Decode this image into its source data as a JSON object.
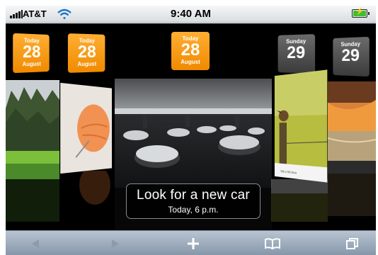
{
  "status_bar": {
    "carrier": "AT&T",
    "time": "9:40 AM",
    "battery_level": 1.0
  },
  "date_tiles": [
    {
      "dow": "Today",
      "day": "28",
      "month": "August",
      "color": "#f39a10"
    },
    {
      "dow": "Today",
      "day": "28",
      "month": "August",
      "color": "#f39a10"
    },
    {
      "dow": "Today",
      "day": "28",
      "month": "August",
      "color": "#f39a10"
    },
    {
      "dow": "Sunday",
      "day": "29",
      "month": "",
      "color": "#4a4a4a"
    },
    {
      "dow": "Sunday",
      "day": "29",
      "month": "",
      "color": "#4a4a4a"
    }
  ],
  "event": {
    "title": "Look for a new car",
    "time": "Today, 6 p.m."
  },
  "toolbar": {
    "icons": [
      "back-arrow-icon",
      "forward-arrow-icon",
      "plus-icon",
      "bookmarks-icon",
      "pages-icon"
    ]
  },
  "colors": {
    "accent": "#f39a10",
    "toolbar": "#9aa9ba"
  }
}
